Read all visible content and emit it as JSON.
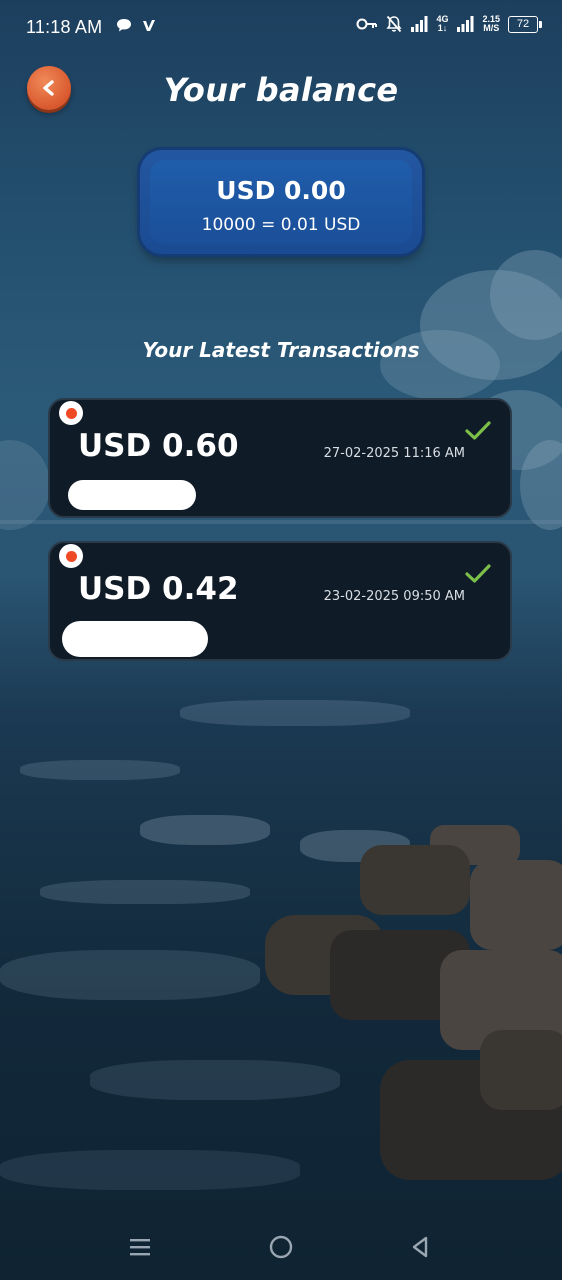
{
  "status_bar": {
    "time": "11:18 AM",
    "network_label_top": "4G",
    "network_label_bottom": "1↓",
    "speed_value": "2.15",
    "speed_unit": "M/S",
    "battery": "72"
  },
  "header": {
    "title": "Your balance",
    "back_icon": "chevron-left-icon"
  },
  "balance": {
    "amount": "USD 0.00",
    "rate": "10000 = 0.01 USD"
  },
  "transactions_section": {
    "title": "Your Latest Transactions",
    "items": [
      {
        "amount": "USD 0.60",
        "datetime": "27-02-2025 11:16 AM",
        "status_icon": "check-icon"
      },
      {
        "amount": "USD 0.42",
        "datetime": "23-02-2025 09:50 AM",
        "status_icon": "check-icon"
      }
    ]
  },
  "nav": {
    "recents_icon": "menu-icon",
    "home_icon": "home-circle-icon",
    "back_icon": "back-triangle-icon"
  },
  "colors": {
    "accent_orange": "#d9582e",
    "balance_card_blue": "#1f5dab",
    "check_green": "#7cc04a",
    "status_dot_red": "#f04a24"
  }
}
